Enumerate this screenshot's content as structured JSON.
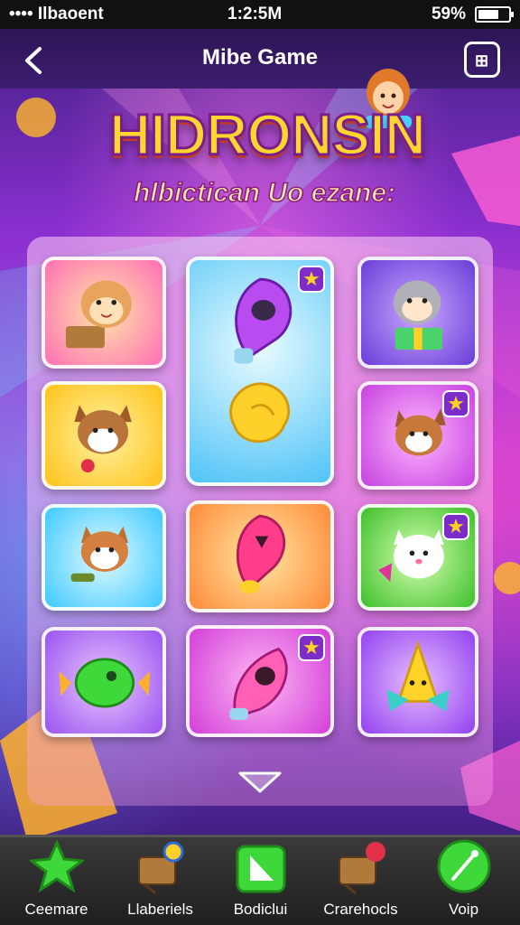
{
  "status_bar": {
    "carrier": "•••• Ilbaoent",
    "time": "1:2:5M",
    "battery_pct": "59%"
  },
  "header": {
    "title": "Mibe Game",
    "back_icon": "chevron-left-icon",
    "menu_icon": "grid-icon"
  },
  "logo": {
    "title": "HIDRONSIN",
    "subtitle": "hlbictican Uo ezane:"
  },
  "board": {
    "tiles": [
      {
        "name": "hamster-money",
        "bg": "#ff7fc4"
      },
      {
        "name": "purple-balloon",
        "bg": "#5cd0ff",
        "starred": true
      },
      {
        "name": "raccoon-box",
        "bg": "#8b5cf0"
      },
      {
        "name": "fox-orange",
        "bg": "#ffd02a"
      },
      {
        "name": "yellow-shell",
        "bg": "#5cd0ff",
        "starred": true
      },
      {
        "name": "fox-purple",
        "bg": "#e45cf0",
        "starred": true
      },
      {
        "name": "fox-blue",
        "bg": "#58d8ff"
      },
      {
        "name": "pink-balloon",
        "bg": "#ff9a3d"
      },
      {
        "name": "white-cat",
        "bg": "#58d63e",
        "starred": true
      },
      {
        "name": "green-candy",
        "bg": "#b967ff"
      },
      {
        "name": "pink-ship",
        "bg": "#e04ee0",
        "starred": true
      },
      {
        "name": "yellow-star",
        "bg": "#b056ff"
      }
    ],
    "star_glyph": "★"
  },
  "nav": [
    {
      "label": "Ceemare",
      "icon": "star-icon"
    },
    {
      "label": "Llaberiels",
      "icon": "podium-icon"
    },
    {
      "label": "Bodiclui",
      "icon": "card-icon"
    },
    {
      "label": "Crarehocls",
      "icon": "chart-icon"
    },
    {
      "label": "Voip",
      "icon": "edit-icon"
    }
  ]
}
